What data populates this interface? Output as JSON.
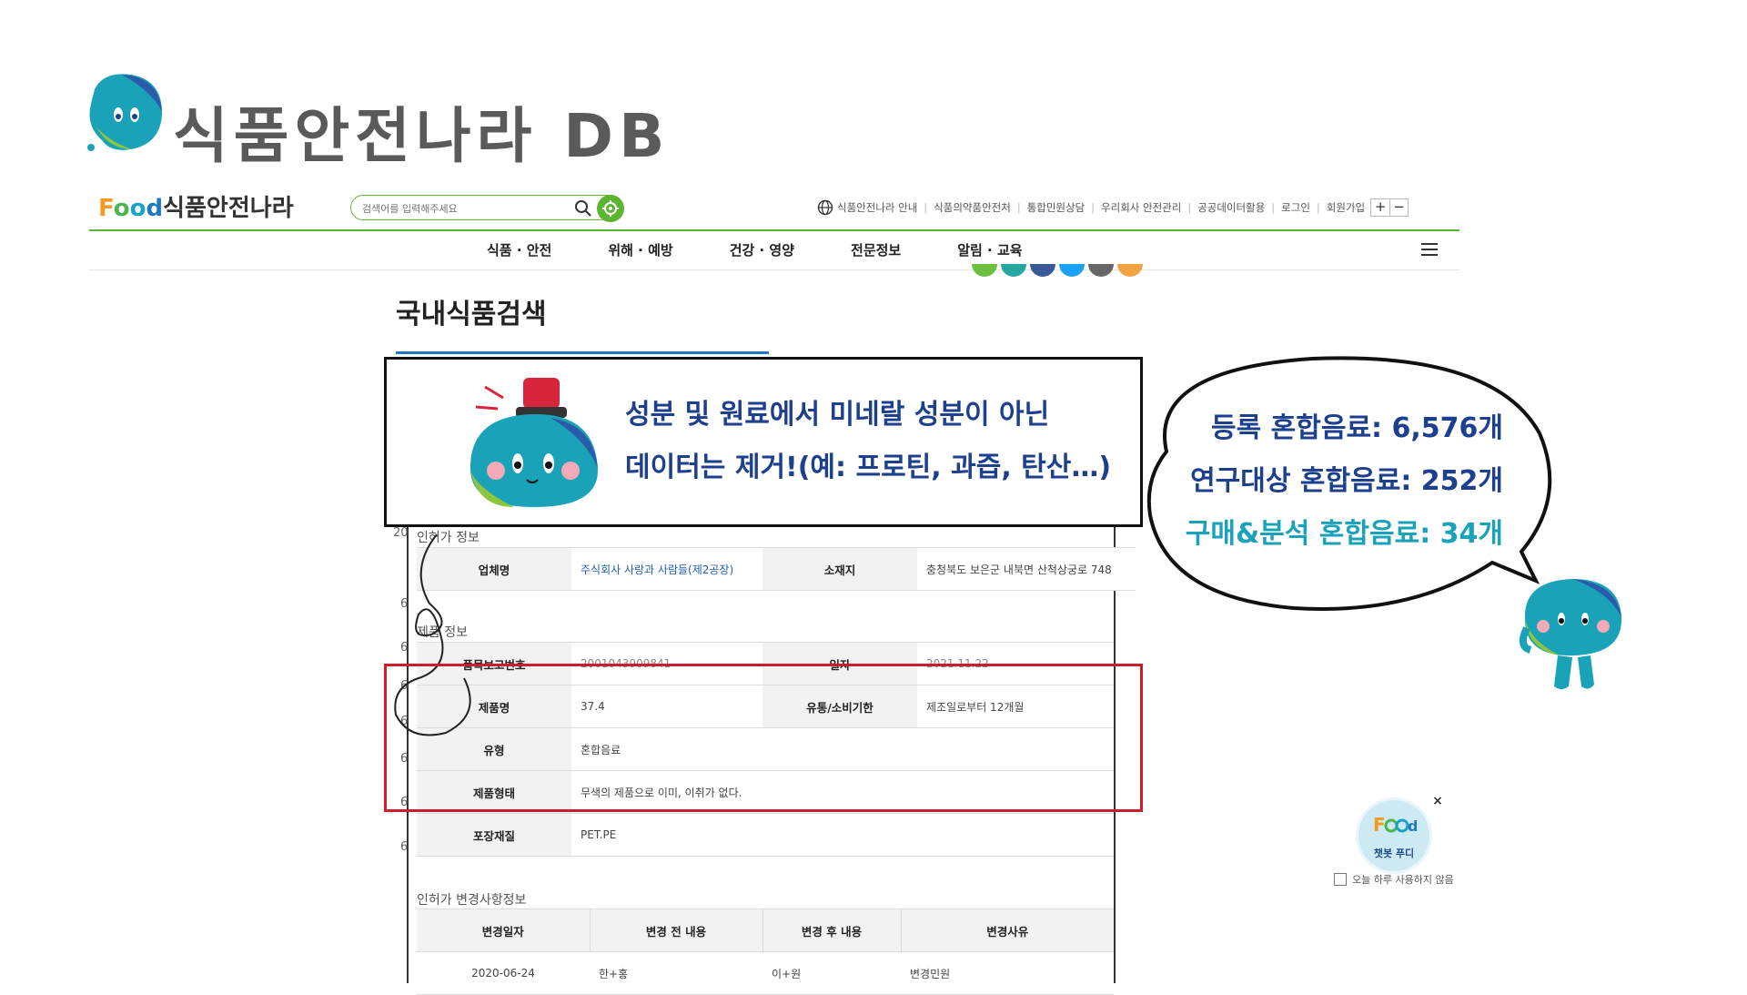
{
  "slide": {
    "title": "식품안전나라 DB"
  },
  "site": {
    "logo_text": "식품안전나라",
    "logo_word": {
      "f": "F",
      "o1": "o",
      "o2": "o",
      "d": "d"
    },
    "search_placeholder": "검색어를 입력해주세요",
    "utility_links": [
      "식품안전나라 안내",
      "식품의약품안전처",
      "통합민원상담",
      "우리회사 안전관리",
      "공공데이터활용",
      "로그인",
      "회원가입"
    ],
    "zoom_in": "+",
    "zoom_out": "−",
    "gnb": [
      "식품 · 안전",
      "위해 · 예방",
      "건강 · 영양",
      "전문정보",
      "알림 · 교육"
    ],
    "brand_color": "#55b437"
  },
  "page": {
    "heading": "국내식품검색"
  },
  "license_section": {
    "label": "인허가 정보",
    "rows": [
      {
        "h1": "업체명",
        "v1": "주식회사 사랑과 사람들(제2공장)",
        "h2": "소재지",
        "v2": "충청북도 보은군 내북면 산척상궁로 748"
      }
    ]
  },
  "product_section": {
    "label": "제품 정보",
    "rows": [
      {
        "h1": "품목보고번호",
        "v1": "2001043909841",
        "h2": "일자",
        "v2": "2021.11.22"
      },
      {
        "h1": "제품명",
        "v1": "37.4",
        "h2": "유통/소비기한",
        "v2": "제조일로부터 12개월"
      },
      {
        "h1": "유형",
        "v1": "혼합음료"
      },
      {
        "h1": "제품형태",
        "v1": "무색의 제품으로 이미, 이취가 없다."
      },
      {
        "h1": "포장재질",
        "v1": "PET.PE"
      }
    ]
  },
  "change_section": {
    "label": "인허가 변경사항정보",
    "headers": [
      "변경일자",
      "변경 전 내용",
      "변경 후 내용",
      "변경사유"
    ],
    "rows": [
      [
        "2020-06-24",
        "한+홍",
        "이+원",
        "변경민원"
      ]
    ]
  },
  "left_numbers": [
    "20",
    "6",
    "6",
    "6",
    "6",
    "6",
    "6",
    "6"
  ],
  "callout": {
    "line1": "성분 및 원료에서 미네랄 성분이 아닌",
    "line2": "데이터는 제거!(예: 프로틴, 과즙, 탄산…)"
  },
  "stats": {
    "registered": "등록 혼합음료: 6,576개",
    "research": "연구대상 혼합음료: 252개",
    "purchase": "구매&분석 혼합음료: 34개",
    "color_dark": "#1c3f8e",
    "color_teal": "#1aa3b8"
  },
  "chatbot": {
    "label": "챗봇 푸디",
    "no_show": "오늘 하루 사용하지 않음",
    "close": "×"
  }
}
